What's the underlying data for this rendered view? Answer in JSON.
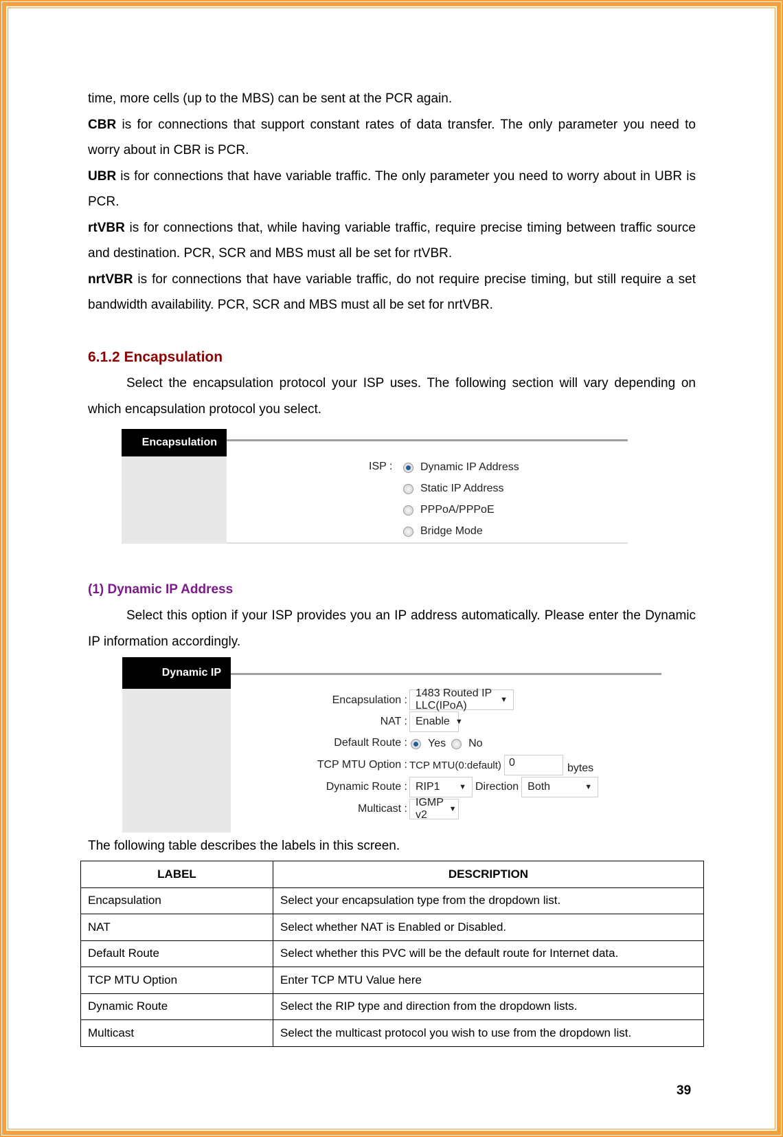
{
  "paragraphs": {
    "p0": "time, more cells (up to the MBS) can be sent at the PCR again.",
    "cbr_term": "CBR",
    "cbr_text": " is for connections that support constant rates of data transfer. The only parameter you need to worry about in CBR is PCR.",
    "ubr_term": "UBR",
    "ubr_text": " is for connections that have variable traffic. The only parameter you need to worry about in UBR is PCR.",
    "rtvbr_term": "rtVBR",
    "rtvbr_text": " is for connections that, while having variable traffic, require precise timing between traffic source and destination. PCR, SCR and MBS must all be set for rtVBR.",
    "nrtvbr_term": "nrtVBR",
    "nrtvbr_text": " is for connections that have variable traffic, do not require precise timing, but still require a set bandwidth availability. PCR, SCR and MBS must all be set for nrtVBR."
  },
  "section": {
    "title": "6.1.2 Encapsulation",
    "intro": "Select the encapsulation protocol your ISP uses. The following section will vary depending on which encapsulation protocol you select."
  },
  "encap_shot": {
    "tab": "Encapsulation",
    "isp_label": "ISP :",
    "options": [
      "Dynamic IP Address",
      "Static IP Address",
      "PPPoA/PPPoE",
      "Bridge Mode"
    ],
    "selected": "Dynamic IP Address"
  },
  "subsection": {
    "title": "(1) Dynamic IP Address",
    "intro": "Select this option if your ISP provides you an IP address automatically. Please enter the Dynamic IP information accordingly."
  },
  "dyn_shot": {
    "tab": "Dynamic IP",
    "encapsulation_label": "Encapsulation :",
    "encapsulation_value": "1483 Routed IP LLC(IPoA)",
    "nat_label": "NAT :",
    "nat_value": "Enable",
    "default_route_label": "Default Route :",
    "yes": "Yes",
    "no": "No",
    "default_route_value": "Yes",
    "mtu_label": "TCP MTU Option :",
    "mtu_prefix": "TCP MTU(0:default)",
    "mtu_value": "0",
    "mtu_unit": "bytes",
    "dynamic_route_label": "Dynamic Route :",
    "dynamic_route_value": "RIP1",
    "direction_label": "Direction",
    "direction_value": "Both",
    "multicast_label": "Multicast :",
    "multicast_value": "IGMP v2"
  },
  "table_intro": "The following table describes the labels in this screen.",
  "table": {
    "headers": [
      "LABEL",
      "DESCRIPTION"
    ],
    "rows": [
      [
        "Encapsulation",
        "Select your encapsulation type from the dropdown list."
      ],
      [
        "NAT",
        "Select whether NAT is Enabled or Disabled."
      ],
      [
        "Default Route",
        "Select whether this PVC will be the default route for Internet data."
      ],
      [
        "TCP MTU Option",
        "Enter TCP MTU Value here"
      ],
      [
        "Dynamic Route",
        "Select the RIP type and direction from the dropdown lists."
      ],
      [
        "Multicast",
        "Select the multicast protocol you wish to use from the dropdown list."
      ]
    ]
  },
  "page_number": "39",
  "colors": {
    "border": "#f7a03c",
    "heading": "#8b0000",
    "subheading": "#7b1a8a"
  }
}
